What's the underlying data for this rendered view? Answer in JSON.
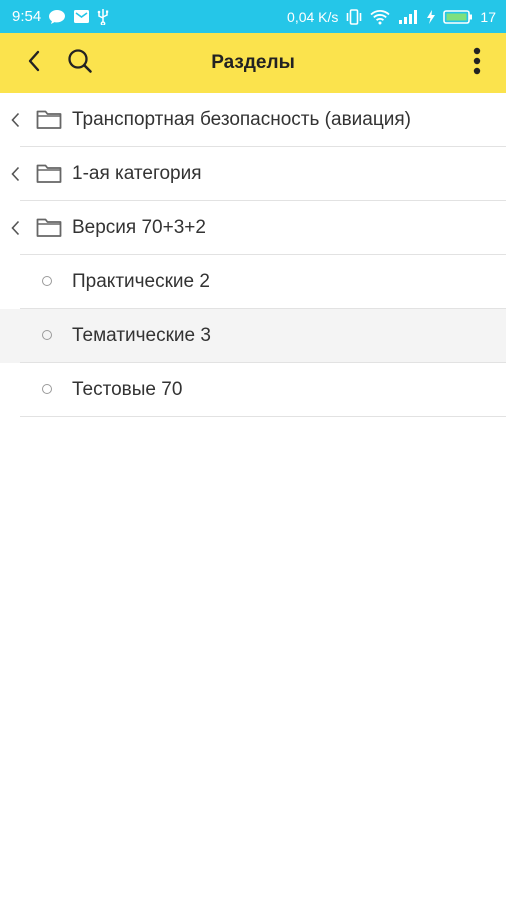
{
  "status_bar": {
    "time": "9:54",
    "speed": "0,04 K/s",
    "battery": "17"
  },
  "toolbar": {
    "title": "Разделы"
  },
  "sections": [
    {
      "label": "Транспортная безопасность (авиация)",
      "kind": "folder"
    },
    {
      "label": "1-ая категория",
      "kind": "folder"
    },
    {
      "label": "Версия 70+3+2",
      "kind": "folder"
    },
    {
      "label": "Практические 2",
      "kind": "item"
    },
    {
      "label": "Тематические 3",
      "kind": "item",
      "highlighted": true
    },
    {
      "label": "Тестовые 70",
      "kind": "item"
    }
  ],
  "colors": {
    "status_bar": "#25c6e8",
    "toolbar": "#fbe34d"
  }
}
